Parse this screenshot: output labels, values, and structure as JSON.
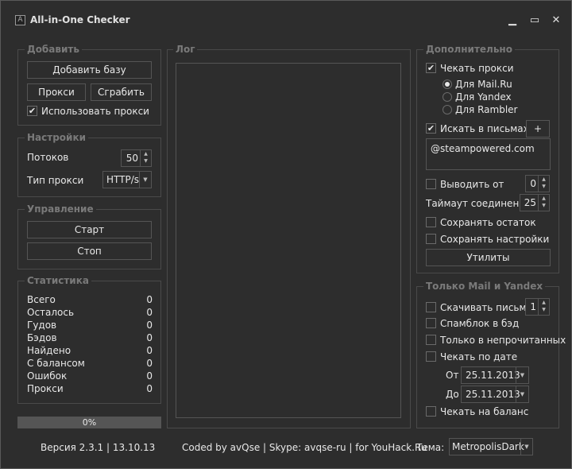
{
  "window": {
    "title": "All-in-One Checker",
    "app_icon": "app-icon",
    "icon_glyph": "A",
    "controls": [
      "minimize-icon",
      "maximize-icon",
      "close-icon"
    ]
  },
  "add": {
    "group": "Добавить",
    "add_base": "Добавить базу",
    "proxy": "Прокси",
    "grab": "Сграбить",
    "use_proxy": "Использовать прокси",
    "use_proxy_checked": true
  },
  "settings": {
    "group": "Настройки",
    "threads_label": "Потоков",
    "threads": "50",
    "proxy_type_label": "Тип прокси",
    "proxy_type": "HTTP/s"
  },
  "control": {
    "group": "Управление",
    "start": "Старт",
    "stop": "Стоп"
  },
  "stats": {
    "group": "Статистика",
    "rows": [
      {
        "label": "Всего",
        "value": "0"
      },
      {
        "label": "Осталось",
        "value": "0"
      },
      {
        "label": "Гудов",
        "value": "0"
      },
      {
        "label": "Бэдов",
        "value": "0"
      },
      {
        "label": "Найдено",
        "value": "0"
      },
      {
        "label": "С балансом",
        "value": "0"
      },
      {
        "label": "Ошибок",
        "value": "0"
      },
      {
        "label": "Прокси",
        "value": "0"
      }
    ]
  },
  "progress": {
    "text": "0%",
    "value": 0
  },
  "log": {
    "group": "Лог"
  },
  "extra": {
    "group": "Дополнительно",
    "check_proxy": "Чекать прокси",
    "check_proxy_checked": true,
    "radios": [
      {
        "label": "Для Mail.Ru",
        "selected": true
      },
      {
        "label": "Для Yandex",
        "selected": false
      },
      {
        "label": "Для Rambler",
        "selected": false
      }
    ],
    "search_letters": "Искать в письмах",
    "search_letters_checked": true,
    "plus": "+",
    "search_text": "@steampowered.com",
    "output_from": "Выводить от",
    "output_from_value": "0",
    "timeout_label": "Таймаут соединения",
    "timeout_value": "25",
    "save_rest": "Сохранять остаток",
    "save_settings": "Сохранять настройки",
    "utilities": "Утилиты"
  },
  "mailyandex": {
    "group": "Только Mail и Yandex",
    "download_letters": "Скачивать письма",
    "download_count": "1",
    "spamblock": "Спамблок в бэд",
    "unread_only": "Только в непрочитанных",
    "by_date": "Чекать по дате",
    "from_label": "От",
    "from_date": "25.11.2013",
    "to_label": "До",
    "to_date": "25.11.2013",
    "check_balance": "Чекать на баланс"
  },
  "footer": {
    "version": "Версия 2.3.1 | 13.10.13",
    "credits": "Coded by avQse | Skype: avqse-ru | for YouHack.Ru",
    "theme_label": "Тема:",
    "theme": "MetropolisDark"
  },
  "colors": {
    "background": "#2d2d2d",
    "border": "#4a4a4a",
    "group_label": "#7a7a7a",
    "text": "#e8e8e8",
    "progress": "#555555"
  }
}
